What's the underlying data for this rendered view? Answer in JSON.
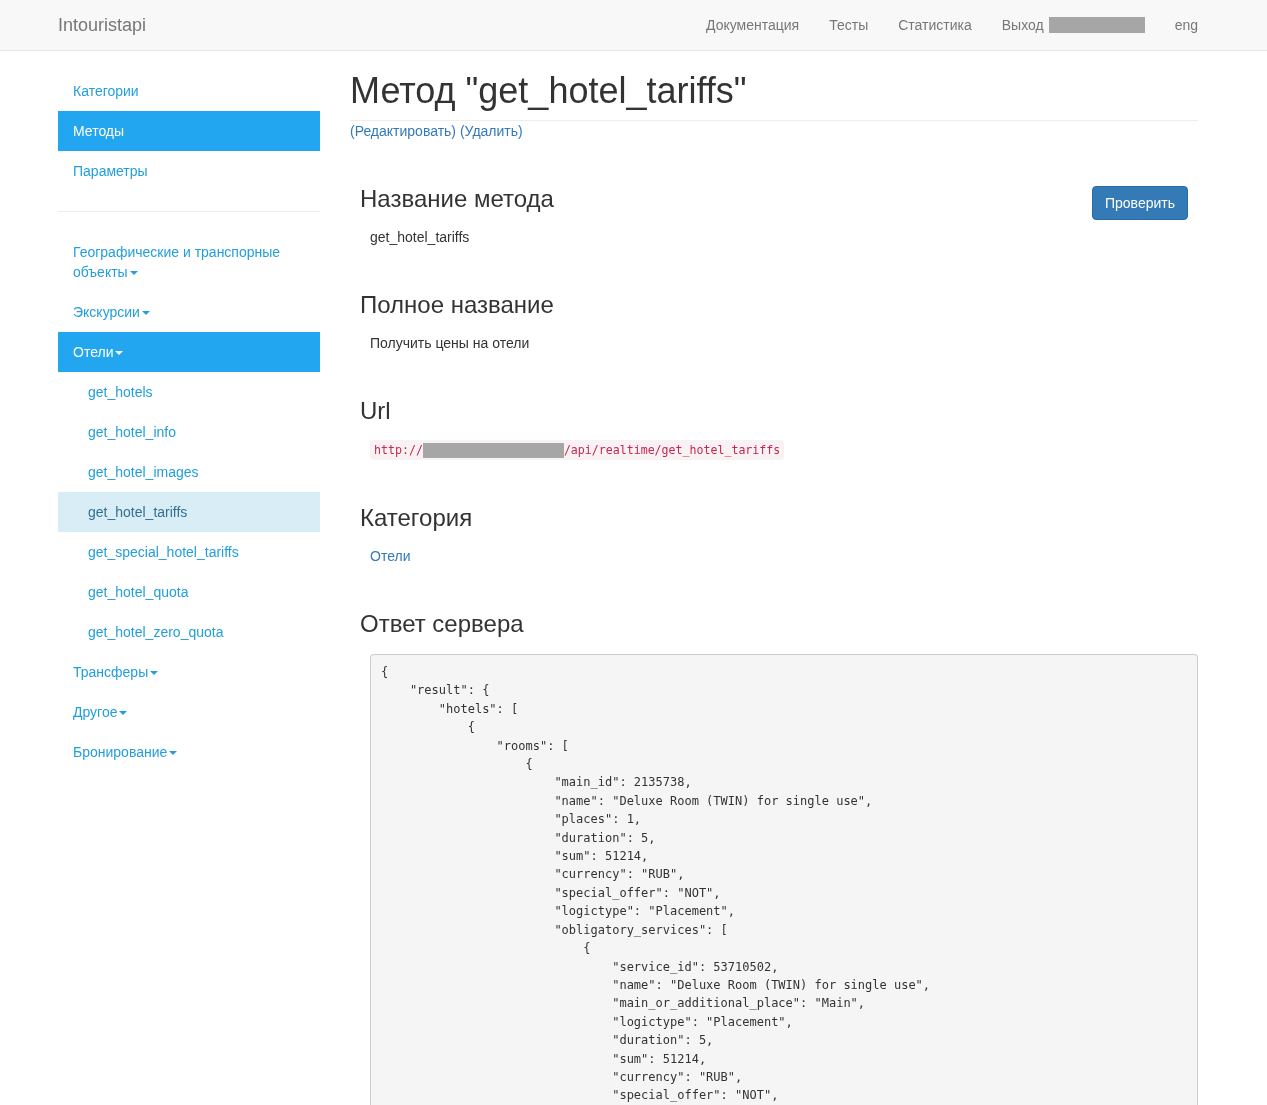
{
  "navbar": {
    "brand": "Intouristapi",
    "links": [
      {
        "kind": "link",
        "label": "Документация"
      },
      {
        "kind": "link",
        "label": "Тесты"
      },
      {
        "kind": "link",
        "label": "Статистика"
      },
      {
        "kind": "user",
        "label": "Выход"
      },
      {
        "kind": "link",
        "label": "eng"
      }
    ]
  },
  "sidebar": {
    "items": [
      {
        "label": "Категории",
        "selected": false
      },
      {
        "label": "Методы",
        "selected": true
      },
      {
        "label": "Параметры",
        "selected": false
      }
    ],
    "groups": [
      {
        "label": "Географические и транспорные объекты",
        "selected": false
      },
      {
        "label": "Экскурсии",
        "selected": false
      },
      {
        "label": "Отели",
        "selected": true,
        "children": [
          {
            "label": "get_hotels",
            "selected": false
          },
          {
            "label": "get_hotel_info",
            "selected": false
          },
          {
            "label": "get_hotel_images",
            "selected": false
          },
          {
            "label": "get_hotel_tariffs",
            "selected": true
          },
          {
            "label": "get_special_hotel_tariffs",
            "selected": false
          },
          {
            "label": "get_hotel_quota",
            "selected": false
          },
          {
            "label": "get_hotel_zero_quota",
            "selected": false
          }
        ]
      },
      {
        "label": "Трансферы",
        "selected": false
      },
      {
        "label": "Другое",
        "selected": false
      },
      {
        "label": "Бронирование",
        "selected": false
      }
    ]
  },
  "main": {
    "title": "Метод \"get_hotel_tariffs\"",
    "actions": [
      "(Редактировать)",
      "(Удалить)"
    ],
    "check_button": "Проверить",
    "sections": [
      {
        "kind": "text",
        "heading": "Название метода",
        "value": "get_hotel_tariffs"
      },
      {
        "kind": "text",
        "heading": "Полное название",
        "value": "Получить цены на отели"
      },
      {
        "kind": "url",
        "heading": "Url",
        "parts": [
          {
            "kind": "text",
            "text": "http://"
          },
          {
            "kind": "redacted"
          },
          {
            "kind": "text",
            "text": "/api/realtime/get_hotel_tariffs"
          }
        ]
      },
      {
        "kind": "link",
        "heading": "Категория",
        "value": "Отели"
      },
      {
        "kind": "code",
        "heading": "Ответ сервера",
        "lines": [
          "{",
          "    \"result\": {",
          "        \"hotels\": [",
          "            {",
          "                \"rooms\": [",
          "                    {",
          "                        \"main_id\": 2135738,",
          "                        \"name\": \"Deluxe Room (TWIN) for single use\",",
          "                        \"places\": 1,",
          "                        \"duration\": 5,",
          "                        \"sum\": 51214,",
          "                        \"currency\": \"RUB\",",
          "                        \"special_offer\": \"NOT\",",
          "                        \"logictype\": \"Placement\",",
          "                        \"obligatory_services\": [",
          "                            {",
          "                                \"service_id\": 53710502,",
          "                                \"name\": \"Deluxe Room (TWIN) for single use\",",
          "                                \"main_or_additional_place\": \"Main\",",
          "                                \"logictype\": \"Placement\",",
          "                                \"duration\": 5,",
          "                                \"sum\": 51214,",
          "                                \"currency\": \"RUB\",",
          "                                \"special_offer\": \"NOT\","
        ]
      }
    ]
  }
}
